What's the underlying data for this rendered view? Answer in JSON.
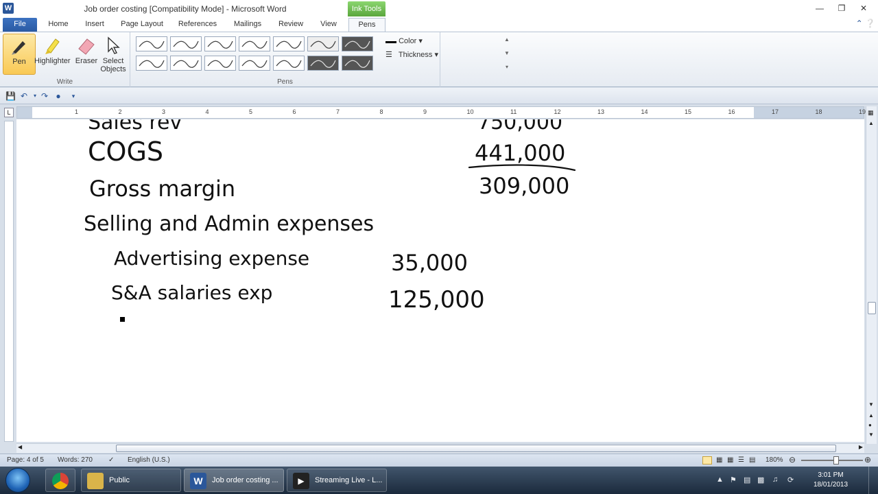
{
  "window": {
    "title": "Job order costing [Compatibility Mode] - Microsoft Word",
    "contextual_tab": "Ink Tools",
    "app_icon_letter": "W"
  },
  "tabs": [
    "File",
    "Home",
    "Insert",
    "Page Layout",
    "References",
    "Mailings",
    "Review",
    "View",
    "Pens"
  ],
  "ribbon": {
    "write_group": {
      "label": "Write",
      "buttons": [
        "Pen",
        "Highlighter",
        "Eraser",
        "Select Objects"
      ]
    },
    "pens_group": {
      "label": "Pens"
    },
    "color_label": "Color",
    "thickness_label": "Thickness"
  },
  "ruler": {
    "numbers": [
      "1",
      "2",
      "3",
      "4",
      "5",
      "6",
      "7",
      "8",
      "9",
      "10",
      "11",
      "12",
      "13",
      "14",
      "15",
      "16",
      "17",
      "18",
      "19"
    ],
    "corner": "L"
  },
  "document": {
    "ink_lines": [
      {
        "text": "Sales rev",
        "amount": "750,000"
      },
      {
        "text": "COGS",
        "amount": "441,000"
      },
      {
        "text": "Gross margin",
        "amount": "309,000"
      },
      {
        "text": "Selling and Admin expenses",
        "amount": ""
      },
      {
        "text": "Advertising expense",
        "amount": "35,000"
      },
      {
        "text": "S&A salaries exp",
        "amount": "125,000"
      }
    ]
  },
  "statusbar": {
    "page": "Page: 4 of 5",
    "words": "Words: 270",
    "language": "English (U.S.)",
    "zoom": "180%"
  },
  "taskbar": {
    "items": [
      {
        "label": "Public",
        "color": "#d9b44a"
      },
      {
        "label": "Job order costing ...",
        "color": "#2b579a"
      },
      {
        "label": "Streaming Live - L...",
        "color": "#222222"
      }
    ],
    "time": "3:01 PM",
    "date": "18/01/2013"
  }
}
